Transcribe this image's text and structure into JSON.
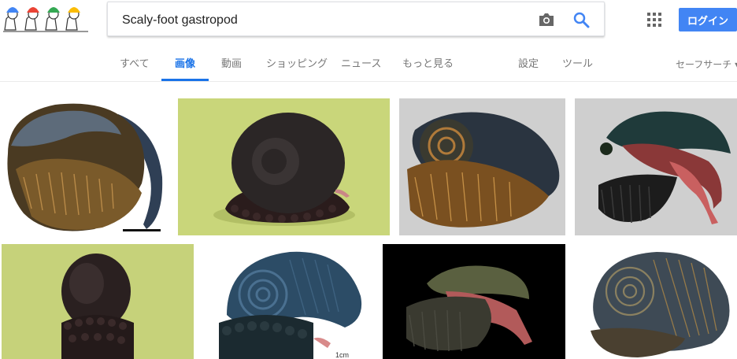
{
  "header": {
    "logo_name": "doodle-logo",
    "search_value": "Scaly-foot gastropod",
    "search_icon": "search-icon",
    "camera_icon": "camera-icon",
    "apps_icon": "apps-grid-icon",
    "login_label": "ログイン"
  },
  "tabs": [
    {
      "label": "すべて",
      "active": false
    },
    {
      "label": "画像",
      "active": true
    },
    {
      "label": "動画",
      "active": false
    },
    {
      "label": "ショッピング",
      "active": false
    },
    {
      "label": "ニュース",
      "active": false
    },
    {
      "label": "もっと見る",
      "active": false
    }
  ],
  "tools": {
    "settings_label": "設定",
    "tools_label": "ツール",
    "safesearch_label": "セーフサーチ ▾"
  },
  "images": [
    {
      "subject": "scaly-foot-snail-white-background",
      "caption": ""
    },
    {
      "subject": "black-snail-green-background",
      "caption": ""
    },
    {
      "subject": "spiral-snail-gray-background",
      "caption": ""
    },
    {
      "subject": "snail-pink-foot-gray-background",
      "caption": ""
    },
    {
      "subject": "black-snail-green-background-2",
      "caption": ""
    },
    {
      "subject": "blue-snail-white-background",
      "caption": "1cm"
    },
    {
      "subject": "snail-black-background",
      "caption": ""
    },
    {
      "subject": "snail-white-background-2",
      "caption": ""
    }
  ],
  "colors": {
    "accent": "#1a73e8",
    "login_button": "#4285f4",
    "tab_text": "#777777"
  }
}
